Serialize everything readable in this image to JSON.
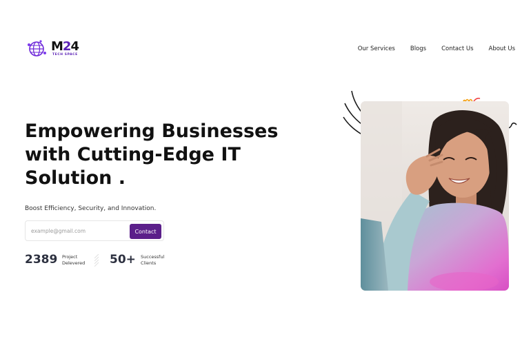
{
  "brand": {
    "name_prefix": "M",
    "name_digit2": "2",
    "name_digit4": "4",
    "tagline": "TECH SPACE",
    "accent_color": "#5b1f8a"
  },
  "nav": {
    "items": [
      "Our Services",
      "Blogs",
      "Contact Us",
      "About Us"
    ]
  },
  "hero": {
    "headline": "Empowering Businesses with Cutting-Edge IT Solution .",
    "subline": "Boost Efficiency, Security, and Innovation.",
    "email_placeholder": "example@gmail.com",
    "cta_label": "Contact"
  },
  "stats": [
    {
      "value": "2389",
      "label": "Project Delevered"
    },
    {
      "value": "50+",
      "label": "Successful Clients"
    }
  ],
  "icons": {
    "logo": "globe-network-icon",
    "decor_left": "swoosh-lines-icon",
    "decor_top": "sparkle-icon",
    "decor_right": "squiggle-icon"
  },
  "image": {
    "subject": "smiling-woman-with-laptop-photo"
  }
}
